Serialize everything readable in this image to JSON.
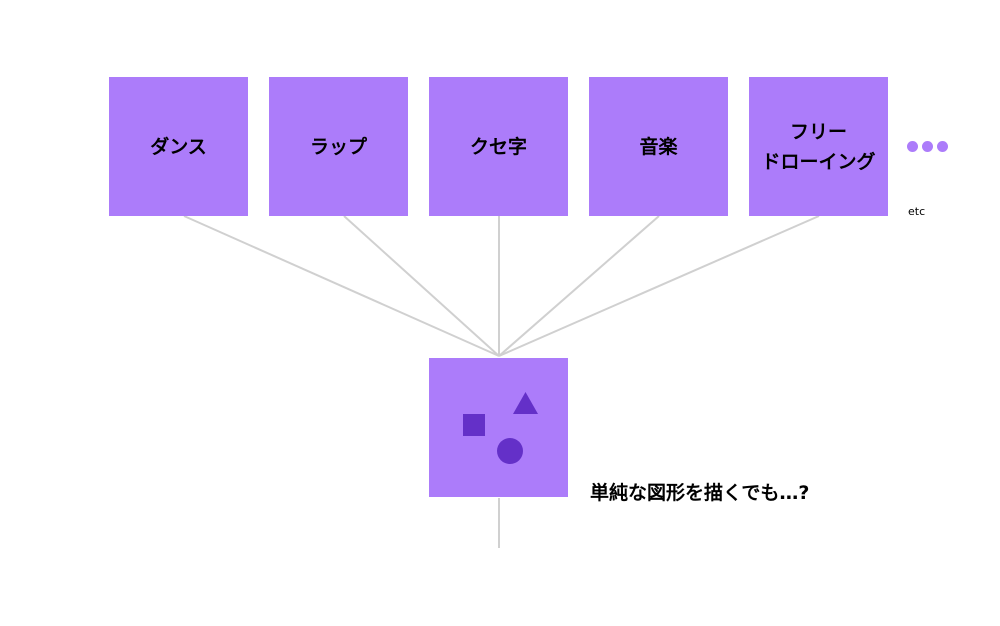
{
  "categories": [
    "ダンス",
    "ラップ",
    "クセ字",
    "音楽",
    "フリー\nドローイング"
  ],
  "more_label": "etc",
  "center": {
    "shapes": [
      "square",
      "triangle",
      "circle"
    ]
  },
  "caption": "単純な図形を描くでも…?",
  "colors": {
    "box": "#ac7cfa",
    "shape": "#6430c8",
    "line": "#d0d0d0",
    "dots": "#ac7cfa"
  }
}
